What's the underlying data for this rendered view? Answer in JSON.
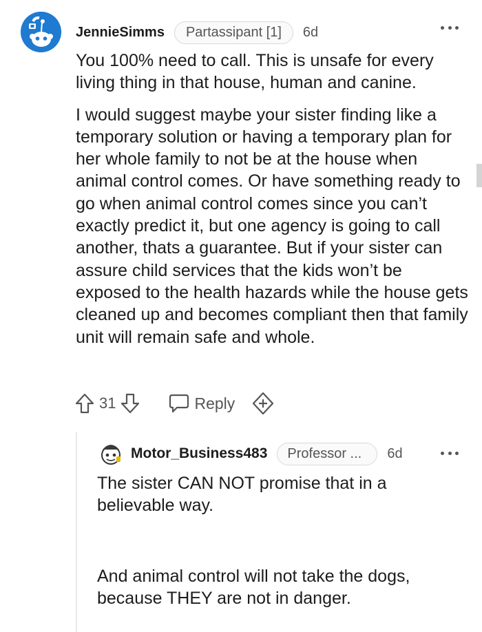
{
  "main_comment": {
    "author": "JennieSimms",
    "flair": "Partassipant [1]",
    "age": "6d",
    "paragraphs": [
      "You 100% need to call. This is unsafe for every living thing in that house, human and canine.",
      "I would suggest maybe your sister finding like a temporary solution or having a temporary plan for her whole family to not be at the house when animal control comes. Or have something ready to go when animal control comes since you can’t exactly predict it, but one agency is going to call another, thats a guarantee. But if your sister can assure child services that the kids won’t be exposed to the health hazards while the house gets cleaned up and becomes compliant then that family unit will remain safe and whole."
    ],
    "vote_count": "31",
    "reply_label": "Reply"
  },
  "reply_comment": {
    "author": "Motor_Business483",
    "flair": "Professor ...",
    "age": "6d",
    "paragraphs": [
      "The sister CAN NOT promise that in a believable way.",
      "And animal control will not take the dogs, because THEY are not in danger."
    ]
  },
  "colors": {
    "avatar_blue": "#1f7ad1",
    "text": "#1c1c1c",
    "meta": "#555555"
  },
  "icons": {
    "upvote": "upvote-arrow-icon",
    "downvote": "downvote-arrow-icon",
    "reply": "speech-bubble-icon",
    "award": "award-plus-icon",
    "more": "more-options-icon"
  }
}
